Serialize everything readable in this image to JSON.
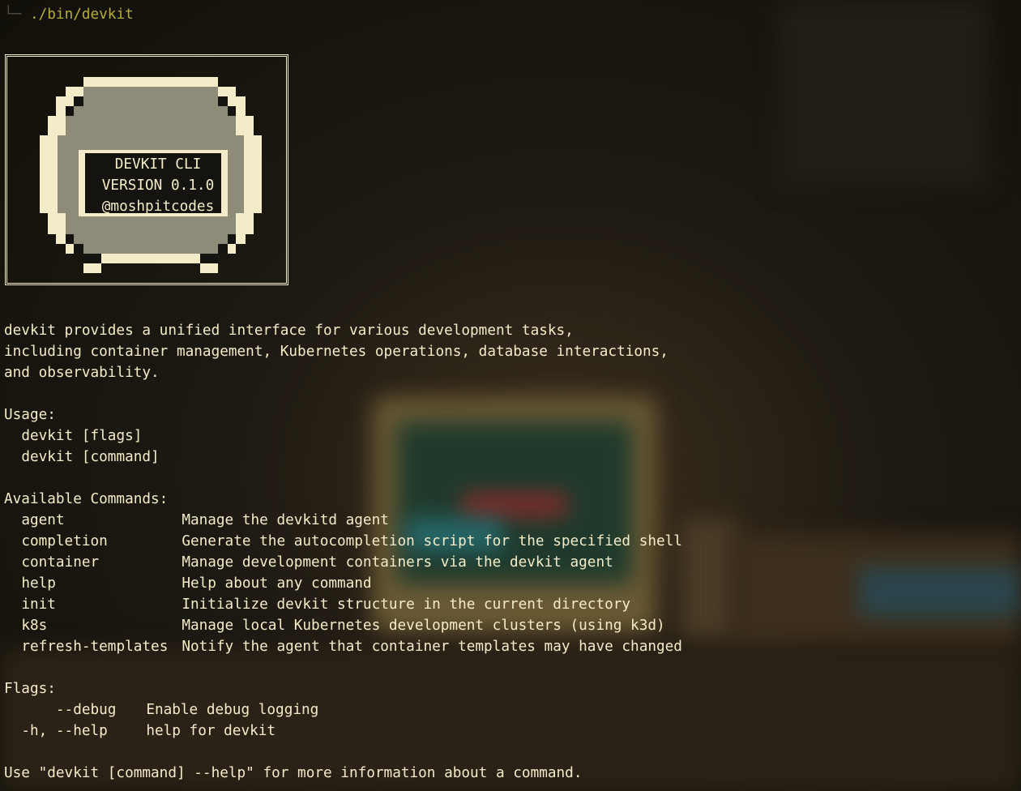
{
  "prompt": {
    "tree_glyph": "└─",
    "command": "./bin/devkit"
  },
  "logo": {
    "line1": "DEVKIT CLI",
    "line2": "VERSION 0.1.0",
    "line3": "@moshpitcodes",
    "colors": {
      "cream": "#f4ecc8",
      "stone": "#8e8b78",
      "dark": "#15130f"
    }
  },
  "description": [
    "devkit provides a unified interface for various development tasks,",
    "including container management, Kubernetes operations, database interactions,",
    "and observability."
  ],
  "usage": {
    "header": "Usage:",
    "lines": [
      "devkit [flags]",
      "devkit [command]"
    ]
  },
  "commands": {
    "header": "Available Commands:",
    "items": [
      {
        "name": "agent",
        "desc": "Manage the devkitd agent"
      },
      {
        "name": "completion",
        "desc": "Generate the autocompletion script for the specified shell"
      },
      {
        "name": "container",
        "desc": "Manage development containers via the devkit agent"
      },
      {
        "name": "help",
        "desc": "Help about any command"
      },
      {
        "name": "init",
        "desc": "Initialize devkit structure in the current directory"
      },
      {
        "name": "k8s",
        "desc": "Manage local Kubernetes development clusters (using k3d)"
      },
      {
        "name": "refresh-templates",
        "desc": "Notify the agent that container templates may have changed"
      }
    ]
  },
  "flags": {
    "header": "Flags:",
    "items": [
      {
        "name": "    --debug",
        "desc": "Enable debug logging"
      },
      {
        "name": "-h, --help",
        "desc": "help for devkit"
      }
    ]
  },
  "footer": "Use \"devkit [command] --help\" for more information about a command."
}
